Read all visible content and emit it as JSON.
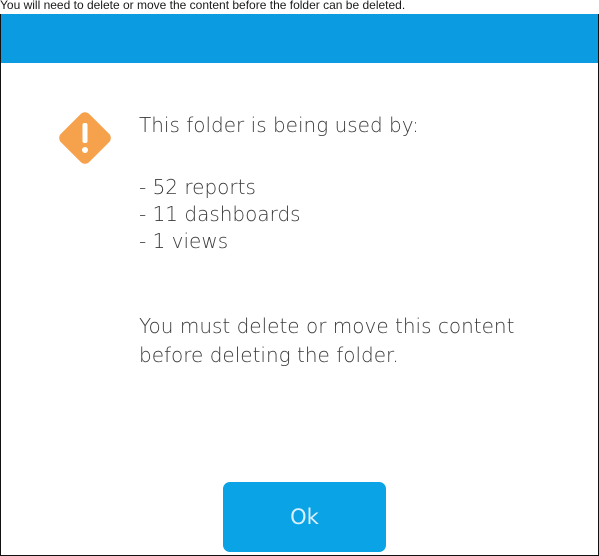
{
  "caption": "You will need to delete or move the content before the folder can be deleted.",
  "dialog": {
    "icon": "warning-diamond-icon",
    "header_color": "#0b9be0",
    "intro": "This folder is being used by:",
    "usage": [
      "- 52 reports",
      "- 11 dashboards",
      "- 1 views"
    ],
    "message": "You must delete or move this content before deleting the folder.",
    "ok_label": "Ok",
    "colors": {
      "accent": "#0aa3e6",
      "warning": "#f6a14c"
    }
  }
}
